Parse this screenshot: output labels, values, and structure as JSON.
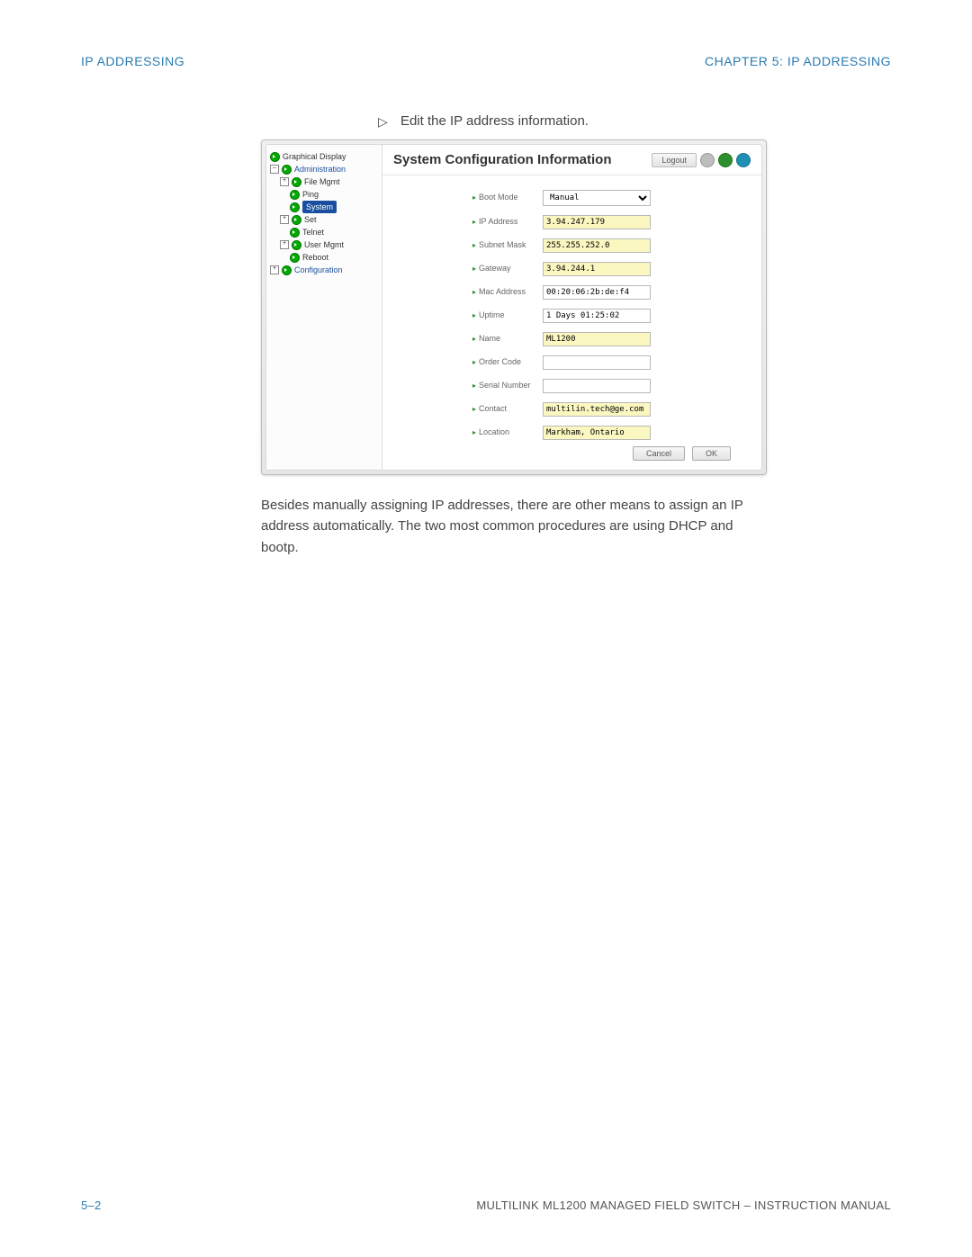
{
  "header": {
    "left": "IP ADDRESSING",
    "right": "CHAPTER 5: IP ADDRESSING"
  },
  "step": "Edit the IP address information.",
  "app": {
    "title": "System Configuration Information",
    "logout": "Logout",
    "sidebar": {
      "graphical_display": "Graphical Display",
      "admin": "Administration",
      "file_mgmt": "File Mgmt",
      "ping": "Ping",
      "system": "System",
      "set": "Set",
      "telnet": "Telnet",
      "user_mgmt": "User Mgmt",
      "reboot": "Reboot",
      "config": "Configuration"
    },
    "fields": {
      "boot_mode": {
        "label": "Boot Mode",
        "value": "Manual",
        "hl": false,
        "type": "select"
      },
      "ip_address": {
        "label": "IP Address",
        "value": "3.94.247.179",
        "hl": true
      },
      "subnet_mask": {
        "label": "Subnet Mask",
        "value": "255.255.252.0",
        "hl": true
      },
      "gateway": {
        "label": "Gateway",
        "value": "3.94.244.1",
        "hl": true
      },
      "mac": {
        "label": "Mac Address",
        "value": "00:20:06:2b:de:f4",
        "hl": false
      },
      "uptime": {
        "label": "Uptime",
        "value": "1 Days 01:25:02",
        "hl": false
      },
      "name": {
        "label": "Name",
        "value": "ML1200",
        "hl": true
      },
      "order_code": {
        "label": "Order Code",
        "value": "",
        "hl": false
      },
      "serial": {
        "label": "Serial Number",
        "value": "",
        "hl": false
      },
      "contact": {
        "label": "Contact",
        "value": "multilin.tech@ge.com",
        "hl": true
      },
      "location": {
        "label": "Location",
        "value": "Markham, Ontario",
        "hl": true
      }
    },
    "buttons": {
      "cancel": "Cancel",
      "ok": "OK"
    }
  },
  "body_text": "Besides manually assigning IP addresses, there are other means to assign an IP address automatically. The two most common procedures are using DHCP and bootp.",
  "footer": {
    "page": "5–2",
    "manual": "MULTILINK ML1200 MANAGED FIELD SWITCH – INSTRUCTION MANUAL"
  }
}
